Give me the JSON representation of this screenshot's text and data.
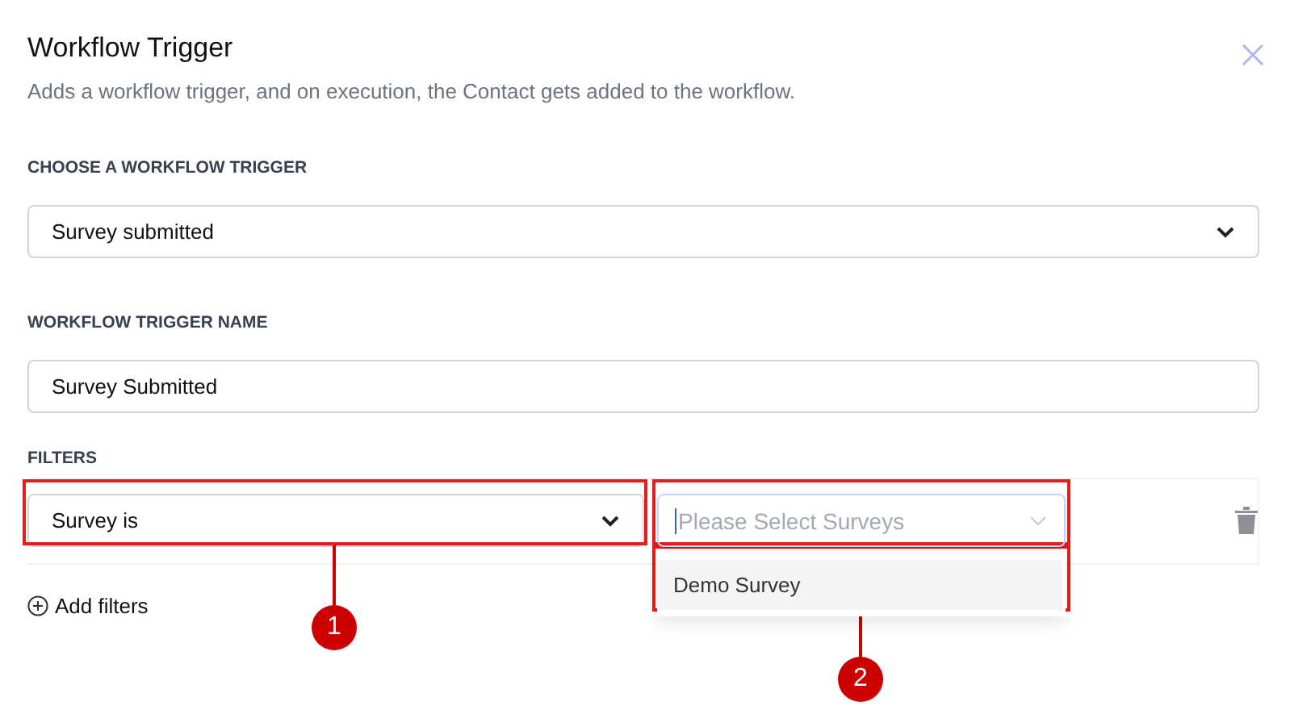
{
  "dialog": {
    "title": "Workflow Trigger",
    "subtitle": "Adds a workflow trigger, and on execution, the Contact gets added to the workflow."
  },
  "trigger": {
    "label": "CHOOSE A WORKFLOW TRIGGER",
    "value": "Survey submitted"
  },
  "name": {
    "label": "WORKFLOW TRIGGER NAME",
    "value": "Survey Submitted"
  },
  "filters": {
    "label": "FILTERS",
    "condition": "Survey is",
    "survey_select": {
      "placeholder": "Please Select Surveys",
      "focused": true,
      "options": [
        {
          "label": "Demo Survey",
          "highlighted": true
        }
      ]
    },
    "add_label": "Add filters"
  },
  "annotations": [
    {
      "number": "1"
    },
    {
      "number": "2"
    }
  ]
}
